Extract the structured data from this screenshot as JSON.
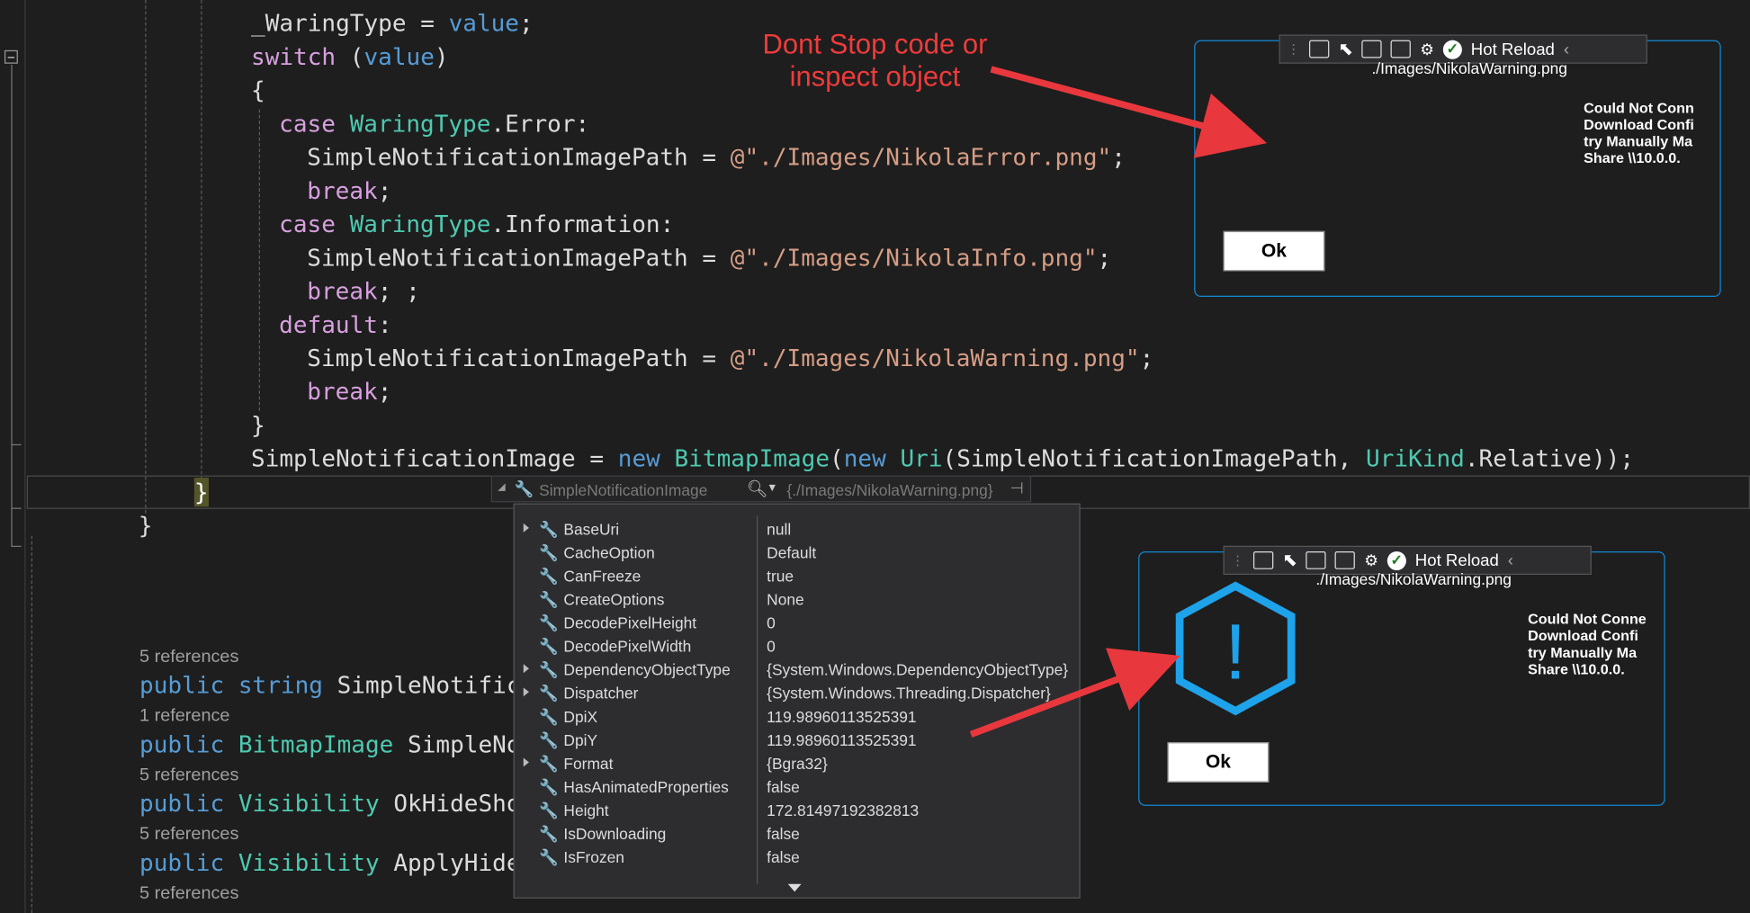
{
  "code": [
    {
      "indent": 9,
      "parts": [
        [
          "id",
          "_WaringType"
        ],
        [
          "pl",
          " = "
        ],
        [
          "kw",
          "value"
        ],
        [
          "pl",
          ";"
        ]
      ]
    },
    {
      "indent": 9,
      "parts": [
        [
          "ctl",
          "switch"
        ],
        [
          "pl",
          " ("
        ],
        [
          "kw",
          "value"
        ],
        [
          "pl",
          ")"
        ]
      ]
    },
    {
      "indent": 9,
      "parts": [
        [
          "pl",
          "{"
        ]
      ]
    },
    {
      "indent": 11,
      "parts": [
        [
          "ctl",
          "case"
        ],
        [
          "pl",
          " "
        ],
        [
          "ty",
          "WaringType"
        ],
        [
          "pl",
          ".Error:"
        ]
      ]
    },
    {
      "indent": 13,
      "parts": [
        [
          "id",
          "SimpleNotificationImagePath"
        ],
        [
          "pl",
          " = "
        ],
        [
          "st",
          "@\"./Images/NikolaError.png\""
        ],
        [
          "pl",
          ";"
        ]
      ]
    },
    {
      "indent": 13,
      "parts": [
        [
          "ctl",
          "break"
        ],
        [
          "pl",
          ";"
        ]
      ]
    },
    {
      "indent": 11,
      "parts": [
        [
          "ctl",
          "case"
        ],
        [
          "pl",
          " "
        ],
        [
          "ty",
          "WaringType"
        ],
        [
          "pl",
          ".Information:"
        ]
      ]
    },
    {
      "indent": 13,
      "parts": [
        [
          "id",
          "SimpleNotificationImagePath"
        ],
        [
          "pl",
          " = "
        ],
        [
          "st",
          "@\"./Images/NikolaInfo.png\""
        ],
        [
          "pl",
          ";"
        ]
      ]
    },
    {
      "indent": 13,
      "parts": [
        [
          "ctl",
          "break"
        ],
        [
          "pl",
          "; ;"
        ]
      ]
    },
    {
      "indent": 11,
      "parts": [
        [
          "ctl",
          "default"
        ],
        [
          "pl",
          ":"
        ]
      ]
    },
    {
      "indent": 13,
      "parts": [
        [
          "id",
          "SimpleNotificationImagePath"
        ],
        [
          "pl",
          " = "
        ],
        [
          "st",
          "@\"./Images/NikolaWarning.png\""
        ],
        [
          "pl",
          ";"
        ]
      ]
    },
    {
      "indent": 13,
      "parts": [
        [
          "ctl",
          "break"
        ],
        [
          "pl",
          ";"
        ]
      ]
    },
    {
      "indent": 9,
      "parts": [
        [
          "pl",
          "}"
        ]
      ]
    },
    {
      "indent": 9,
      "parts": [
        [
          "id",
          "SimpleNotificationImage"
        ],
        [
          "pl",
          " = "
        ],
        [
          "kw",
          "new"
        ],
        [
          "pl",
          " "
        ],
        [
          "ty",
          "BitmapImage"
        ],
        [
          "pl",
          "("
        ],
        [
          "kw",
          "new"
        ],
        [
          "pl",
          " "
        ],
        [
          "ty",
          "Uri"
        ],
        [
          "pl",
          "(SimpleNotificationImagePath, "
        ],
        [
          "ty",
          "UriKind"
        ],
        [
          "pl",
          ".Relative));"
        ]
      ]
    }
  ],
  "close_brace_1": "}",
  "close_brace_2": "}",
  "members": [
    {
      "refs": "5 references",
      "parts": [
        [
          "kw",
          "public"
        ],
        [
          "pl",
          " "
        ],
        [
          "kw",
          "string"
        ],
        [
          "pl",
          " SimpleNotific"
        ]
      ]
    },
    {
      "refs": "1 reference",
      "parts": [
        [
          "kw",
          "public"
        ],
        [
          "pl",
          " "
        ],
        [
          "ty",
          "BitmapImage"
        ],
        [
          "pl",
          " SimpleNo"
        ]
      ]
    },
    {
      "refs": "5 references",
      "parts": [
        [
          "kw",
          "public"
        ],
        [
          "pl",
          " "
        ],
        [
          "ty",
          "Visibility"
        ],
        [
          "pl",
          " OkHideSho"
        ]
      ]
    },
    {
      "refs": "5 references",
      "parts": [
        [
          "kw",
          "public"
        ],
        [
          "pl",
          " "
        ],
        [
          "ty",
          "Visibility"
        ],
        [
          "pl",
          " ApplyHide"
        ]
      ]
    },
    {
      "refs": "5 references",
      "parts": []
    }
  ],
  "annotation": "Dont Stop code or\ninspect object",
  "datatip": {
    "name": "SimpleNotificationImage",
    "value": "{./Images/NikolaWarning.png}",
    "rows": [
      {
        "name": "BaseUri",
        "value": "null",
        "expandable": true
      },
      {
        "name": "CacheOption",
        "value": "Default",
        "expandable": false
      },
      {
        "name": "CanFreeze",
        "value": "true",
        "expandable": false
      },
      {
        "name": "CreateOptions",
        "value": "None",
        "expandable": false
      },
      {
        "name": "DecodePixelHeight",
        "value": "0",
        "expandable": false
      },
      {
        "name": "DecodePixelWidth",
        "value": "0",
        "expandable": false
      },
      {
        "name": "DependencyObjectType",
        "value": "{System.Windows.DependencyObjectType}",
        "expandable": true
      },
      {
        "name": "Dispatcher",
        "value": "{System.Windows.Threading.Dispatcher}",
        "expandable": true
      },
      {
        "name": "DpiX",
        "value": "119.98960113525391",
        "expandable": false
      },
      {
        "name": "DpiY",
        "value": "119.98960113525391",
        "expandable": false
      },
      {
        "name": "Format",
        "value": "{Bgra32}",
        "expandable": true
      },
      {
        "name": "HasAnimatedProperties",
        "value": "false",
        "expandable": false
      },
      {
        "name": "Height",
        "value": "172.81497192382813",
        "expandable": false
      },
      {
        "name": "IsDownloading",
        "value": "false",
        "expandable": false
      },
      {
        "name": "IsFrozen",
        "value": "false",
        "expandable": false
      }
    ]
  },
  "preview": {
    "hot_reload": "Hot Reload",
    "path": "./Images/NikolaWarning.png",
    "message": "Could Not Conne\nDownload Confi\ntry Manually Ma\nShare \\\\10.0.0.",
    "message_top": "Could Not Conn\nDownload Confi\ntry Manually Ma\nShare \\\\10.0.0.",
    "ok": "Ok",
    "warning_glyph": "!"
  },
  "colors": {
    "accent": "#0e8ad6",
    "arrow": "#e8383d",
    "keyword": "#569cd6",
    "type": "#4ec9b0",
    "string": "#d69d85",
    "control": "#d8a0df"
  }
}
